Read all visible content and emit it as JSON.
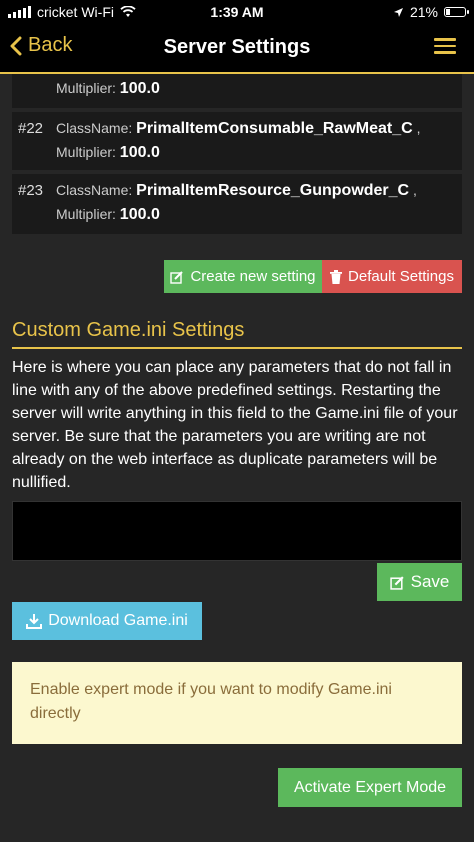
{
  "status_bar": {
    "carrier": "cricket Wi-Fi",
    "time": "1:39 AM",
    "battery": "21%",
    "battery_level": 0.21
  },
  "nav": {
    "back_label": "Back",
    "title": "Server Settings"
  },
  "settings": [
    {
      "index": "",
      "classname_label": "",
      "classname": "",
      "multiplier_label": "Multiplier:",
      "multiplier": "100.0"
    },
    {
      "index": "#22",
      "classname_label": "ClassName:",
      "classname": "PrimalItemConsumable_RawMeat_C",
      "separator": ",",
      "multiplier_label": "Multiplier:",
      "multiplier": "100.0"
    },
    {
      "index": "#23",
      "classname_label": "ClassName:",
      "classname": "PrimalItemResource_Gunpowder_C",
      "separator": ",",
      "multiplier_label": "Multiplier:",
      "multiplier": "100.0"
    }
  ],
  "buttons": {
    "create": "Create new setting",
    "default": "Default Settings",
    "save": "Save",
    "download": "Download Game.ini",
    "activate": "Activate Expert Mode"
  },
  "custom_ini": {
    "title": "Custom Game.ini Settings",
    "description": "Here is where you can place any parameters that do not fall in line with any of the above predefined settings. Restarting the server will write anything in this field to the Game.ini file of your server. Be sure that the parameters you are writing are not already on the web interface as duplicate parameters will be nullified.",
    "value": ""
  },
  "alert": {
    "text": "Enable expert mode if you want to modify Game.ini directly"
  },
  "colors": {
    "accent": "#e8c34a",
    "success": "#5cb85c",
    "danger": "#d9534f",
    "info": "#5bc0de",
    "warning_bg": "#fcf8cf"
  }
}
